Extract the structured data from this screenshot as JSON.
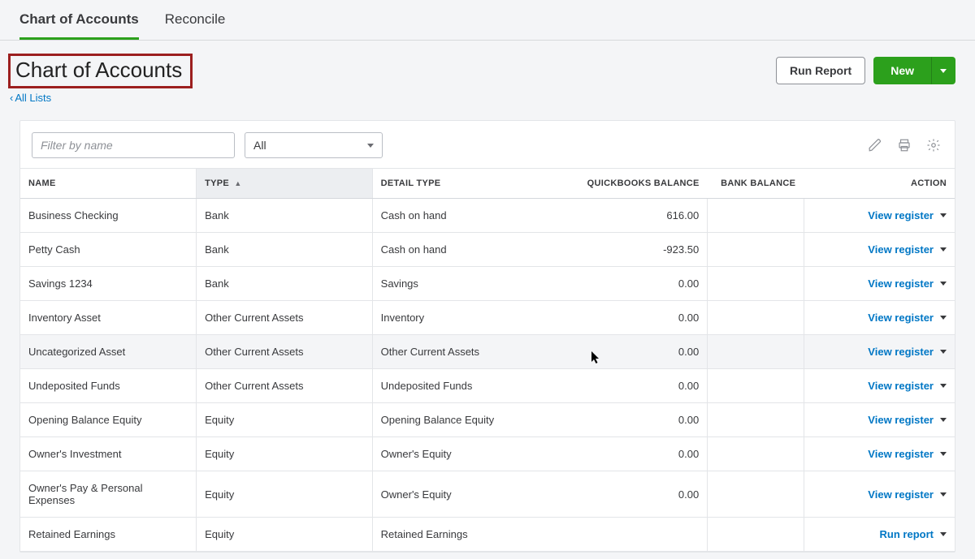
{
  "tabs": {
    "chart": "Chart of Accounts",
    "reconcile": "Reconcile"
  },
  "header": {
    "title": "Chart of Accounts",
    "back_link": "All Lists",
    "run_report": "Run Report",
    "new": "New"
  },
  "toolbar": {
    "filter_placeholder": "Filter by name",
    "type_filter_value": "All"
  },
  "columns": {
    "name": "NAME",
    "type": "TYPE",
    "detail": "DETAIL TYPE",
    "qb_balance": "QUICKBOOKS BALANCE",
    "bank_balance": "BANK BALANCE",
    "action": "ACTION"
  },
  "actions": {
    "view_register": "View register",
    "run_report": "Run report"
  },
  "rows": [
    {
      "name": "Business Checking",
      "type": "Bank",
      "detail": "Cash on hand",
      "qb": "616.00",
      "bb": "",
      "action": "view_register"
    },
    {
      "name": "Petty Cash",
      "type": "Bank",
      "detail": "Cash on hand",
      "qb": "-923.50",
      "bb": "",
      "action": "view_register"
    },
    {
      "name": "Savings 1234",
      "type": "Bank",
      "detail": "Savings",
      "qb": "0.00",
      "bb": "",
      "action": "view_register"
    },
    {
      "name": "Inventory Asset",
      "type": "Other Current Assets",
      "detail": "Inventory",
      "qb": "0.00",
      "bb": "",
      "action": "view_register"
    },
    {
      "name": "Uncategorized Asset",
      "type": "Other Current Assets",
      "detail": "Other Current Assets",
      "qb": "0.00",
      "bb": "",
      "action": "view_register",
      "hover": true
    },
    {
      "name": "Undeposited Funds",
      "type": "Other Current Assets",
      "detail": "Undeposited Funds",
      "qb": "0.00",
      "bb": "",
      "action": "view_register"
    },
    {
      "name": "Opening Balance Equity",
      "type": "Equity",
      "detail": "Opening Balance Equity",
      "qb": "0.00",
      "bb": "",
      "action": "view_register"
    },
    {
      "name": "Owner's Investment",
      "type": "Equity",
      "detail": "Owner's Equity",
      "qb": "0.00",
      "bb": "",
      "action": "view_register"
    },
    {
      "name": "Owner's Pay & Personal Expenses",
      "type": "Equity",
      "detail": "Owner's Equity",
      "qb": "0.00",
      "bb": "",
      "action": "view_register"
    },
    {
      "name": "Retained Earnings",
      "type": "Equity",
      "detail": "Retained Earnings",
      "qb": "",
      "bb": "",
      "action": "run_report"
    }
  ]
}
